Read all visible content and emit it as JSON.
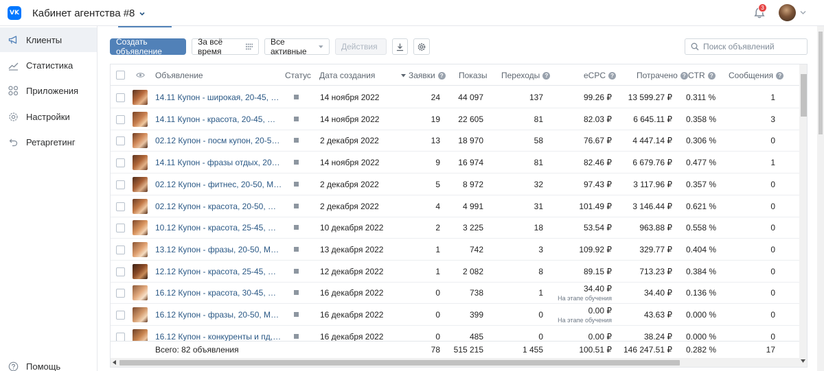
{
  "header": {
    "logo_text": "VK",
    "cabinet_title": "Кабинет агентства #8",
    "notifications_count": "3"
  },
  "sidebar": {
    "items": [
      {
        "label": "Клиенты",
        "icon": "megaphone-icon",
        "active": true
      },
      {
        "label": "Статистика",
        "icon": "chart-line-icon"
      },
      {
        "label": "Приложения",
        "icon": "apps-grid-icon"
      },
      {
        "label": "Настройки",
        "icon": "gear-icon"
      },
      {
        "label": "Ретаргетинг",
        "icon": "retarget-arrow-icon"
      }
    ],
    "help_label": "Помощь"
  },
  "toolbar": {
    "create_label": "Создать объявление",
    "period_label": "За всё время",
    "filter_label": "Все активные",
    "actions_label": "Действия",
    "search_placeholder": "Поиск объявлений"
  },
  "table": {
    "columns": {
      "ad": "Объявление",
      "status": "Статус",
      "created": "Дата создания",
      "leads": "Заявки",
      "impressions": "Показы",
      "clicks": "Переходы",
      "ecpc": "eCPC",
      "spent": "Потрачено",
      "ctr": "CTR",
      "messages": "Сообщения"
    },
    "rows": [
      {
        "name": "14.11 Купон - широкая, 20-45, Ж +...",
        "date": "14 ноября 2022",
        "leads": "24",
        "impressions": "44 097",
        "clicks": "137",
        "ecpc": "99.26 ₽",
        "ecpc_note": "",
        "spent": "13 599.27 ₽",
        "ctr": "0.311 %",
        "messages": "1"
      },
      {
        "name": "14.11 Купон - красота, 20-45, МЖ +...",
        "date": "14 ноября 2022",
        "leads": "19",
        "impressions": "22 605",
        "clicks": "81",
        "ecpc": "82.03 ₽",
        "ecpc_note": "",
        "spent": "6 645.11 ₽",
        "ctr": "0.358 %",
        "messages": "3"
      },
      {
        "name": "02.12 Купон - посм купон, 20-50, М...",
        "date": "2 декабря 2022",
        "leads": "13",
        "impressions": "18 970",
        "clicks": "58",
        "ecpc": "76.67 ₽",
        "ecpc_note": "",
        "spent": "4 447.14 ₽",
        "ctr": "0.306 %",
        "messages": "0"
      },
      {
        "name": "14.11 Купон - фразы отдых, 20-50, ...",
        "date": "14 ноября 2022",
        "leads": "9",
        "impressions": "16 974",
        "clicks": "81",
        "ecpc": "82.46 ₽",
        "ecpc_note": "",
        "spent": "6 679.76 ₽",
        "ctr": "0.477 %",
        "messages": "1"
      },
      {
        "name": "02.12 Купон - фитнес, 20-50, МЖ +...",
        "date": "2 декабря 2022",
        "leads": "5",
        "impressions": "8 972",
        "clicks": "32",
        "ecpc": "97.43 ₽",
        "ecpc_note": "",
        "spent": "3 117.96 ₽",
        "ctr": "0.357 %",
        "messages": "0"
      },
      {
        "name": "02.12 Купон - красота, 20-50, МЖ +...",
        "date": "2 декабря 2022",
        "leads": "4",
        "impressions": "4 991",
        "clicks": "31",
        "ecpc": "101.49 ₽",
        "ecpc_note": "",
        "spent": "3 146.44 ₽",
        "ctr": "0.621 %",
        "messages": "0"
      },
      {
        "name": "10.12 Купон - красота, 25-45, Ж +5...",
        "date": "10 декабря 2022",
        "leads": "2",
        "impressions": "3 225",
        "clicks": "18",
        "ecpc": "53.54 ₽",
        "ecpc_note": "",
        "spent": "963.88 ₽",
        "ctr": "0.558 %",
        "messages": "0"
      },
      {
        "name": "13.12 Купон - фразы, 20-50, МЖ +5...",
        "date": "13 декабря 2022",
        "leads": "1",
        "impressions": "742",
        "clicks": "3",
        "ecpc": "109.92 ₽",
        "ecpc_note": "",
        "spent": "329.77 ₽",
        "ctr": "0.404 %",
        "messages": "0"
      },
      {
        "name": "12.12 Купон - красота, 25-45, Ж +5...",
        "date": "12 декабря 2022",
        "leads": "1",
        "impressions": "2 082",
        "clicks": "8",
        "ecpc": "89.15 ₽",
        "ecpc_note": "",
        "spent": "713.23 ₽",
        "ctr": "0.384 %",
        "messages": "0"
      },
      {
        "name": "16.12 Купон - красота, 30-45, Ж +5...",
        "date": "16 декабря 2022",
        "leads": "0",
        "impressions": "738",
        "clicks": "1",
        "ecpc": "34.40 ₽",
        "ecpc_note": "На этапе обучения",
        "spent": "34.40 ₽",
        "ctr": "0.136 %",
        "messages": "0"
      },
      {
        "name": "16.12 Купон - фразы, 20-50, МЖ +5...",
        "date": "16 декабря 2022",
        "leads": "0",
        "impressions": "399",
        "clicks": "0",
        "ecpc": "0.00 ₽",
        "ecpc_note": "На этапе обучения",
        "spent": "43.63 ₽",
        "ctr": "0.000 %",
        "messages": "0"
      },
      {
        "name": "16.12 Купон - конкуренты и пд, 20...",
        "date": "16 декабря 2022",
        "leads": "0",
        "impressions": "485",
        "clicks": "0",
        "ecpc": "0.00 ₽",
        "ecpc_note": "",
        "spent": "38.24 ₽",
        "ctr": "0.000 %",
        "messages": "0"
      }
    ],
    "totals": {
      "label": "Всего: 82 объявления",
      "leads": "78",
      "impressions": "515 215",
      "clicks": "1 455",
      "ecpc": "100.51 ₽",
      "spent": "146 247.51 ₽",
      "ctr": "0.282 %",
      "messages": "17"
    }
  },
  "colors": {
    "accent": "#5181b8",
    "link": "#2a5885",
    "vk_blue": "#0077ff",
    "badge_red": "#e64646"
  }
}
